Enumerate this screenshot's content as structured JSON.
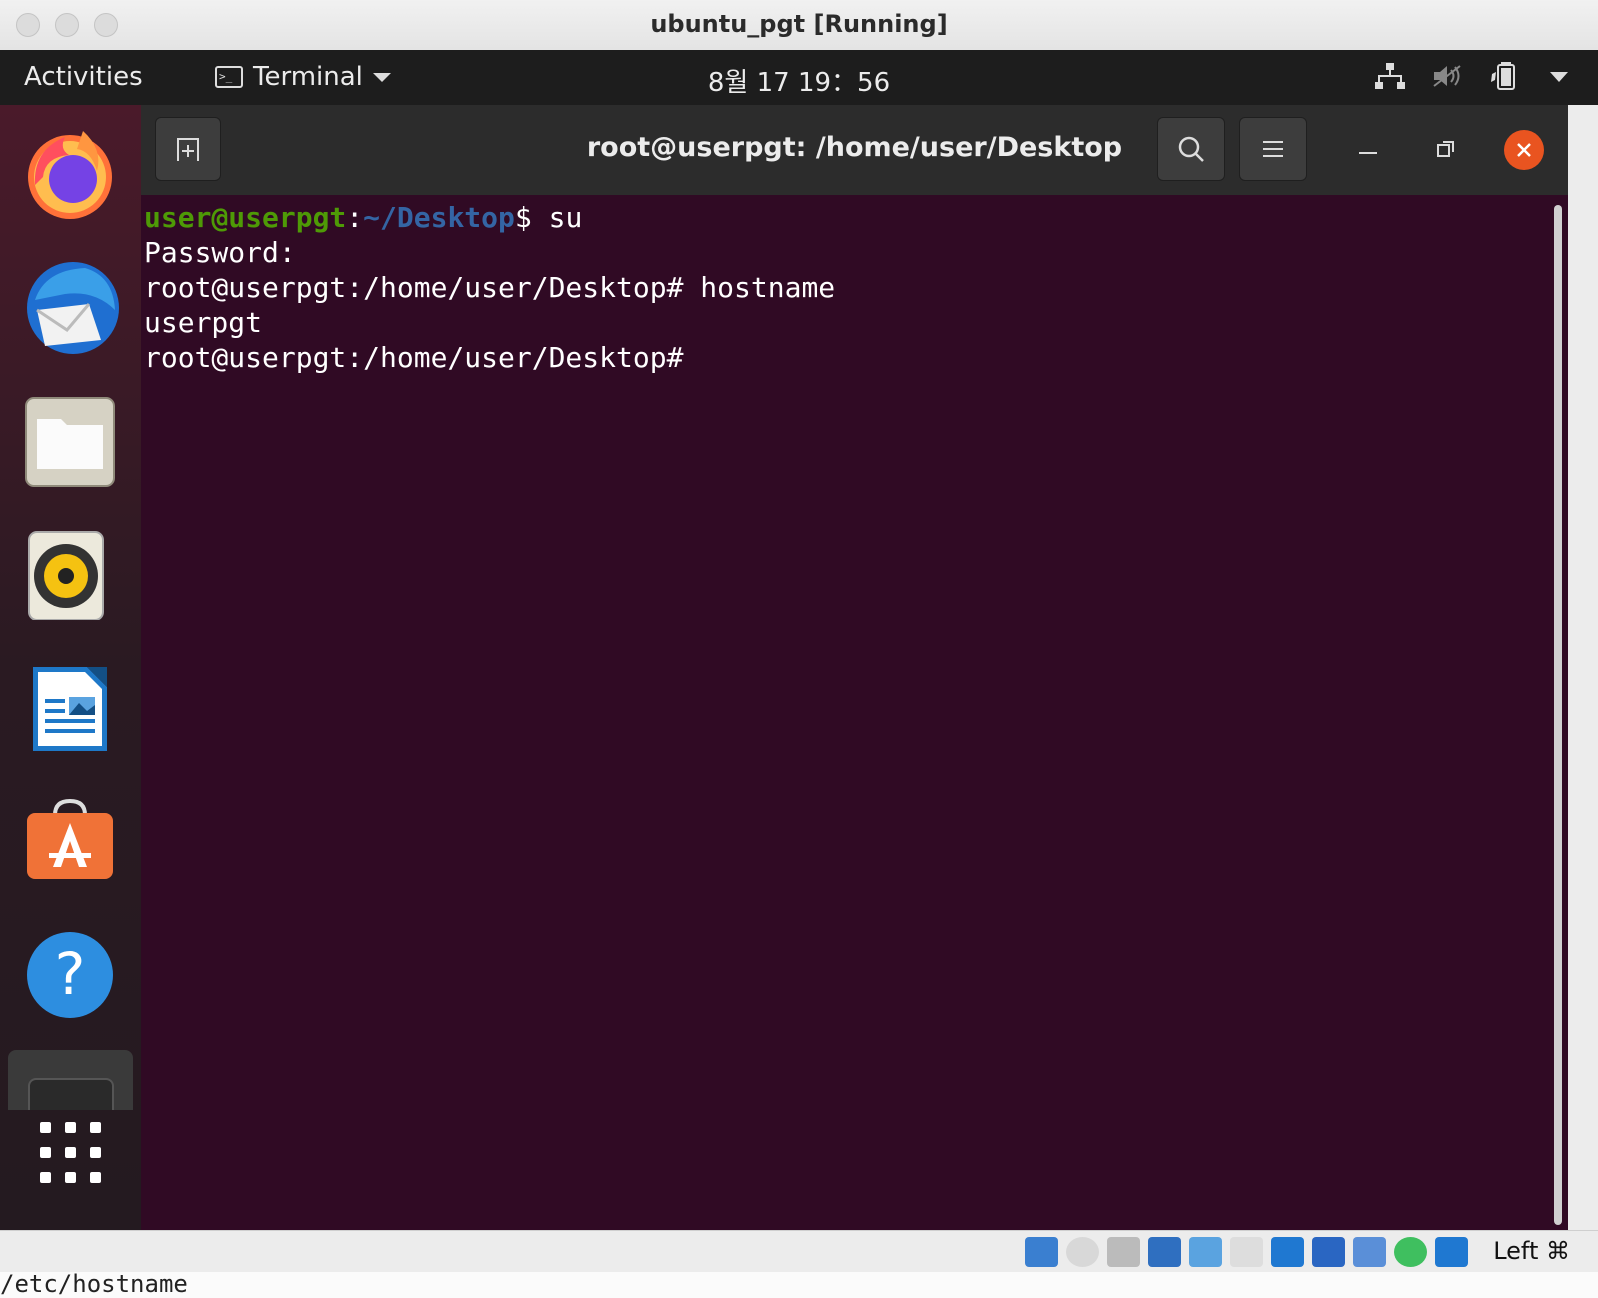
{
  "host_window": {
    "title": "ubuntu_pgt [Running]"
  },
  "topbar": {
    "activities": "Activities",
    "app_menu": "Terminal",
    "clock": "8월 17  19：56"
  },
  "dock": {
    "items": [
      "firefox-icon",
      "thunderbird-icon",
      "files-icon",
      "rhythmbox-icon",
      "libreoffice-writer-icon",
      "ubuntu-software-icon",
      "help-icon",
      "terminal-icon",
      "show-apps-icon"
    ]
  },
  "terminal": {
    "title": "root@userpgt: /home/user/Desktop",
    "lines": {
      "l1_user": "user@userpgt",
      "l1_colon": ":",
      "l1_path": "~/Desktop",
      "l1_cmd": "$ su",
      "l2": "Password:",
      "l3": "root@userpgt:/home/user/Desktop# hostname",
      "l4": "userpgt",
      "l5": "root@userpgt:/home/user/Desktop#"
    }
  },
  "vbox_status": {
    "host_key": "Left ⌘"
  },
  "bottom_strip": {
    "text": "/etc/hostname"
  },
  "colors": {
    "terminal_bg": "#300a24",
    "prompt_user": "#4e9a06",
    "prompt_path": "#3465a4",
    "accent": "#e95420"
  }
}
